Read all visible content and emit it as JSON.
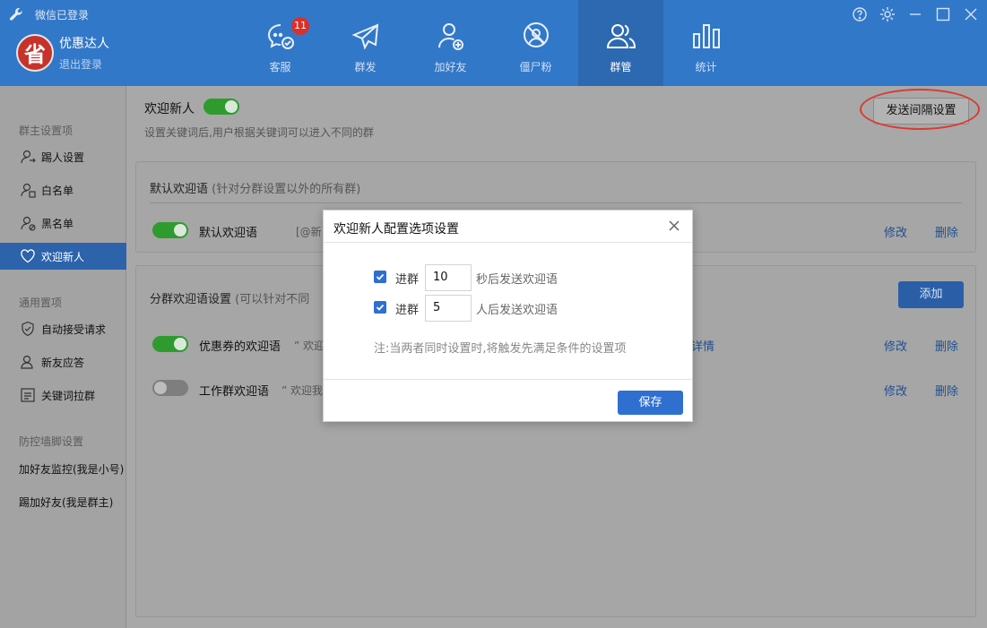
{
  "header": {
    "status": "微信已登录",
    "avatar_char": "省",
    "username": "优惠达人",
    "logout": "退出登录",
    "nav": [
      {
        "label": "客服",
        "badge": "11"
      },
      {
        "label": "群发"
      },
      {
        "label": "加好友"
      },
      {
        "label": "僵尸粉"
      },
      {
        "label": "群管",
        "active": true
      },
      {
        "label": "统计"
      }
    ]
  },
  "sidebar": {
    "group1": "群主设置项",
    "items1": [
      "踢人设置",
      "白名单",
      "黑名单",
      "欢迎新人"
    ],
    "group2": "通用置项",
    "items2": [
      "自动接受请求",
      "新友应答",
      "关键词拉群"
    ],
    "group3": "防控墙脚设置",
    "items3": [
      "加好友监控(我是小号)",
      "踢加好友(我是群主)"
    ]
  },
  "main": {
    "title": "欢迎新人",
    "desc": "设置关键词后,用户根据关键词可以进入不同的群",
    "interval_button": "发送间隔设置",
    "default_card": {
      "title": "默认欢迎语",
      "title_sub": "(针对分群设置以外的所有群)",
      "row_name": "默认欢迎语",
      "row_text": "[@新",
      "edit": "修改",
      "delete": "删除"
    },
    "group_card": {
      "title": "分群欢迎语设置",
      "title_sub": "(可以针对不同",
      "add": "添加",
      "rows": [
        {
          "name": "优惠券的欢迎语",
          "text": "” 欢迎",
          "detail": "详情",
          "edit": "修改",
          "delete": "删除"
        },
        {
          "name": "工作群欢迎语",
          "text": "” 欢迎我",
          "edit": "修改",
          "delete": "删除"
        }
      ]
    }
  },
  "modal": {
    "title": "欢迎新人配置选项设置",
    "row1": {
      "label": "进群",
      "value": "10",
      "suffix": "秒后发送欢迎语"
    },
    "row2": {
      "label": "进群",
      "value": "5",
      "suffix": "人后发送欢迎语"
    },
    "note": "注:当两者同时设置时,将触发先满足条件的设置项",
    "save": "保存"
  },
  "colors": {
    "header": "#3278c8",
    "accent": "#2f6fd0",
    "toggle_on": "#2f9b2f",
    "annotation": "#d93b30"
  }
}
